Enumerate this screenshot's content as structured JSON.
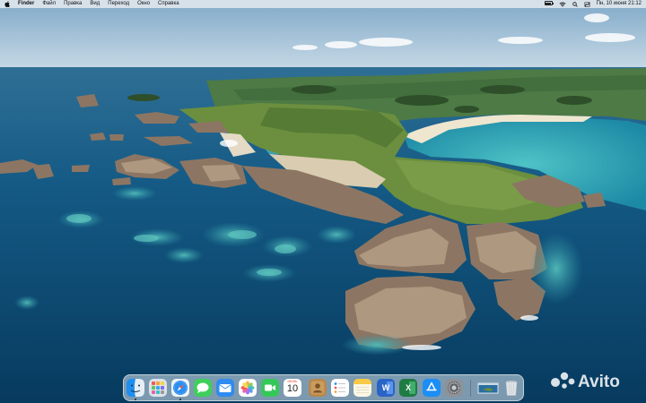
{
  "menubar": {
    "app_name": "Finder",
    "menus": [
      "Файл",
      "Правка",
      "Вид",
      "Переход",
      "Окно",
      "Справка"
    ],
    "clock": "Пн, 10 июня  21:12"
  },
  "dock": {
    "apps": [
      {
        "name": "Finder",
        "icon": "finder-icon",
        "running": true
      },
      {
        "name": "Launchpad",
        "icon": "launchpad-icon",
        "running": false
      },
      {
        "name": "Safari",
        "icon": "safari-icon",
        "running": true
      },
      {
        "name": "Messages",
        "icon": "messages-icon",
        "running": false
      },
      {
        "name": "Mail",
        "icon": "mail-icon",
        "running": false
      },
      {
        "name": "Photos",
        "icon": "photos-icon",
        "running": false
      },
      {
        "name": "FaceTime",
        "icon": "facetime-icon",
        "running": false
      },
      {
        "name": "Calendar",
        "icon": "calendar-icon",
        "running": false
      },
      {
        "name": "Contacts",
        "icon": "contacts-icon",
        "running": false
      },
      {
        "name": "Reminders",
        "icon": "reminders-icon",
        "running": false
      },
      {
        "name": "Notes",
        "icon": "notes-icon",
        "running": false
      },
      {
        "name": "Microsoft Word",
        "icon": "word-icon",
        "running": false
      },
      {
        "name": "Microsoft Excel",
        "icon": "excel-icon",
        "running": false
      },
      {
        "name": "App Store",
        "icon": "app-store-icon",
        "running": false
      },
      {
        "name": "System Settings",
        "icon": "system-settings-icon",
        "running": false
      },
      {
        "name": "Desktop thumbnail",
        "icon": "screenshot-thumbnail-icon",
        "running": false
      },
      {
        "name": "Trash",
        "icon": "trash-icon",
        "running": false
      }
    ],
    "calendar_month": "ИЮНЬ",
    "calendar_day": "10",
    "word_letter": "W",
    "excel_letter": "X"
  },
  "watermark": {
    "text": "Avito"
  },
  "colors": {
    "sea_deep": "#0a3f66",
    "sea_shallow": "#2aa6b8",
    "land_green": "#5f8a3c",
    "rock": "#9b8672",
    "sky": "#a9c6dc"
  }
}
